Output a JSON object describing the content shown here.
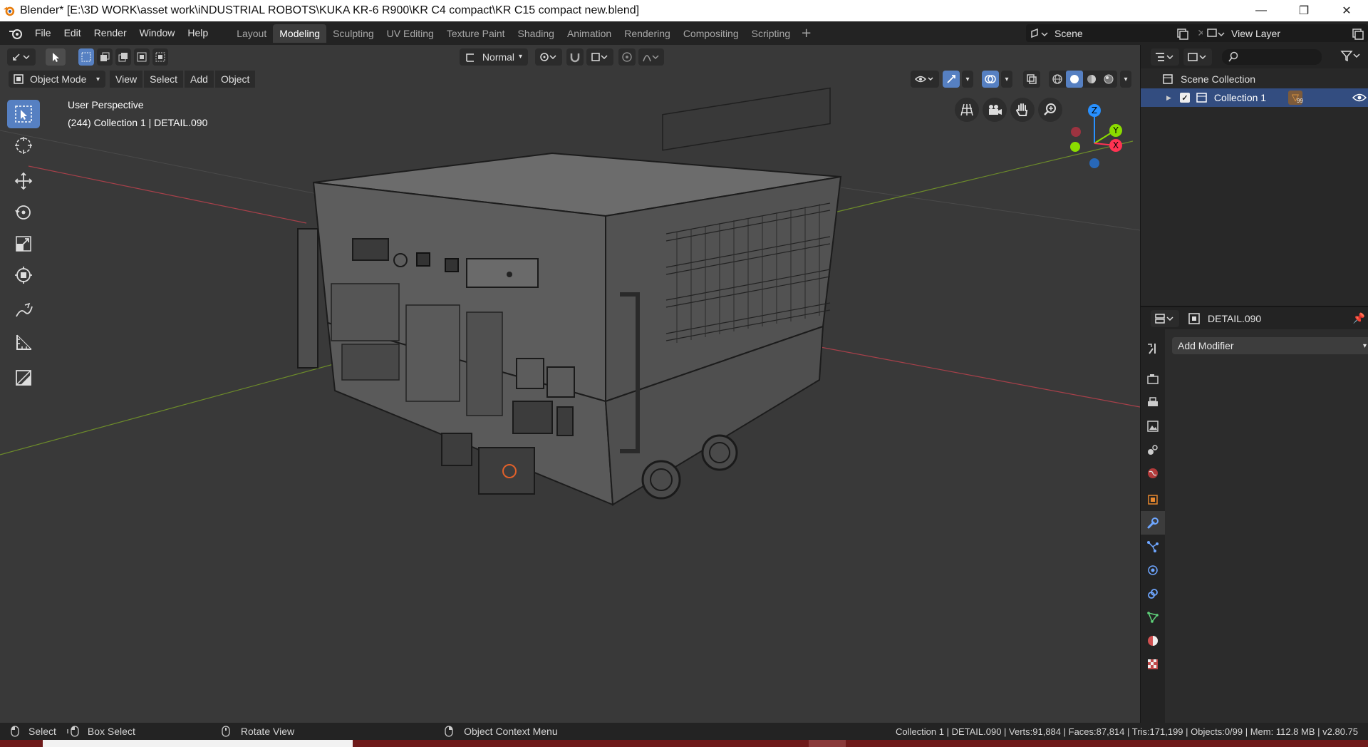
{
  "titlebar": {
    "title": "Blender* [E:\\3D WORK\\asset work\\iNDUSTRIAL ROBOTS\\KUKA KR-6 R900\\KR C4 compact\\KR C15 compact new.blend]",
    "minimize": "—",
    "maximize": "❐",
    "close": "✕"
  },
  "menu": {
    "items": [
      "File",
      "Edit",
      "Render",
      "Window",
      "Help"
    ]
  },
  "workspaces": {
    "tabs": [
      "Layout",
      "Modeling",
      "Sculpting",
      "UV Editing",
      "Texture Paint",
      "Shading",
      "Animation",
      "Rendering",
      "Compositing",
      "Scripting"
    ],
    "active": "Modeling",
    "add": "+"
  },
  "scene": {
    "name": "Scene",
    "view_layer": "View Layer"
  },
  "viewport": {
    "mode": "Object Mode",
    "menus": [
      "View",
      "Select",
      "Add",
      "Object"
    ],
    "orientation": "Normal",
    "perspective_label": "User Perspective",
    "object_info": "(244) Collection 1 | DETAIL.090",
    "gizmo_axes": {
      "z": "Z",
      "y": "Y",
      "x": "X"
    }
  },
  "outliner": {
    "root": "Scene Collection",
    "collection": "Collection 1",
    "collection_count": "99",
    "search_placeholder": ""
  },
  "properties": {
    "object_name": "DETAIL.090",
    "add_modifier": "Add Modifier"
  },
  "statusbar": {
    "select": "Select",
    "box_select": "Box Select",
    "rotate_view": "Rotate View",
    "context_menu": "Object Context Menu",
    "stats": "Collection 1 | DETAIL.090 | Verts:91,884 | Faces:87,814 | Tris:171,199 | Objects:0/99 | Mem: 112.8 MB | v2.80.75"
  },
  "colors": {
    "accent": "#5680c2",
    "selected_row": "#334d80",
    "axis_x": "#ff3352",
    "axis_y": "#8bdc00",
    "axis_z": "#2890ff"
  }
}
